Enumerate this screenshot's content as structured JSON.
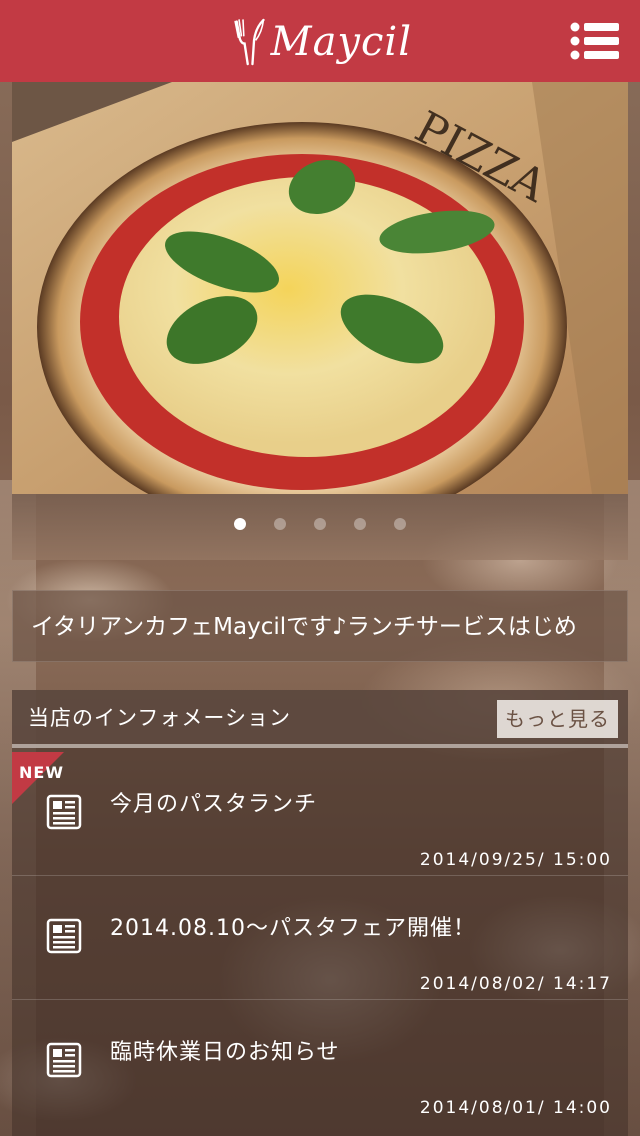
{
  "header": {
    "logo_text": "Maycil",
    "brand_color": "#c23a44",
    "menu_icon": "list-menu-icon"
  },
  "hero": {
    "photo": "pizza-margherita-photo",
    "board_text": "PIZZA",
    "slide_count": 5,
    "active_slide": 1
  },
  "ticker": {
    "text": "イタリアンカフェMaycilです♪ランチサービスはじめ"
  },
  "info": {
    "title": "当店のインフォメーション",
    "more_label": "もっと見る",
    "new_badge": "NEW",
    "items": [
      {
        "title": "今月のパスタランチ",
        "date": "2014/09/25/ 15:00",
        "icon": "newspaper-icon"
      },
      {
        "title": "2014.08.10～パスタフェア開催！",
        "date": "2014/08/02/ 14:17",
        "icon": "newspaper-icon"
      },
      {
        "title": "臨時休業日のお知らせ",
        "date": "2014/08/01/ 14:00",
        "icon": "newspaper-icon"
      }
    ]
  }
}
